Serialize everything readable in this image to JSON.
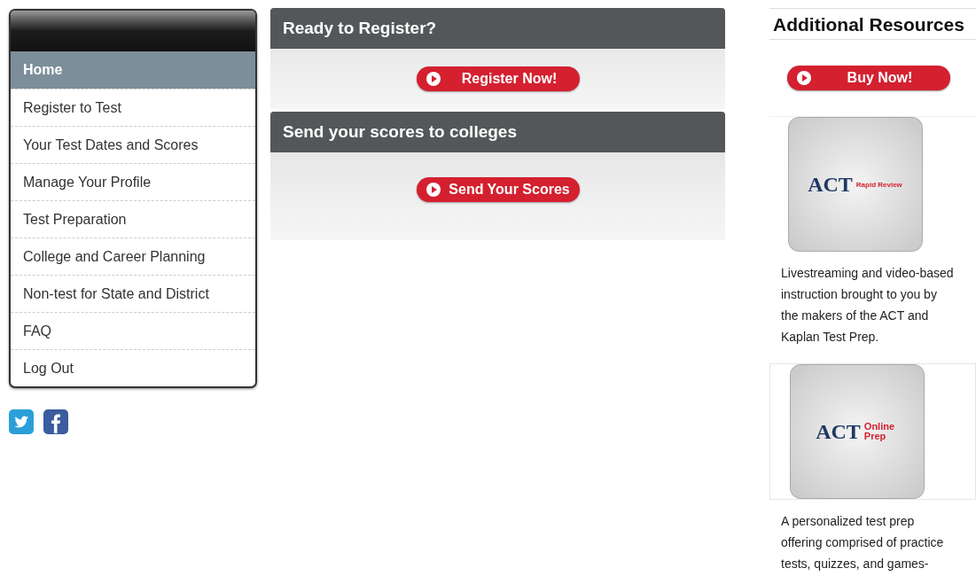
{
  "nav": {
    "items": [
      {
        "label": "Home",
        "selected": true
      },
      {
        "label": "Register to Test",
        "selected": false
      },
      {
        "label": "Your Test Dates and Scores",
        "selected": false
      },
      {
        "label": "Manage Your Profile",
        "selected": false
      },
      {
        "label": "Test Preparation",
        "selected": false
      },
      {
        "label": "College and Career Planning",
        "selected": false
      },
      {
        "label": "Non-test for State and District",
        "selected": false
      },
      {
        "label": "FAQ",
        "selected": false
      },
      {
        "label": "Log Out",
        "selected": false
      }
    ]
  },
  "social": [
    {
      "kind": "twitter"
    },
    {
      "kind": "facebook"
    }
  ],
  "panels": [
    {
      "title": "Ready to Register?",
      "button": "Register Now!"
    },
    {
      "title": "Send your scores to colleges",
      "button": "Send Your Scores"
    }
  ],
  "resources": {
    "title": "Additional Resources",
    "button": "Buy Now!",
    "products": [
      {
        "logo": "ACT",
        "tag": "Rapid Review",
        "description": "Livestreaming and video-based instruction brought to you by the makers of the ACT and Kaplan Test Prep."
      },
      {
        "logo": "ACT",
        "tag": "Online Prep",
        "description": "A personalized test prep offering comprised of practice tests, quizzes, and games-"
      }
    ]
  }
}
